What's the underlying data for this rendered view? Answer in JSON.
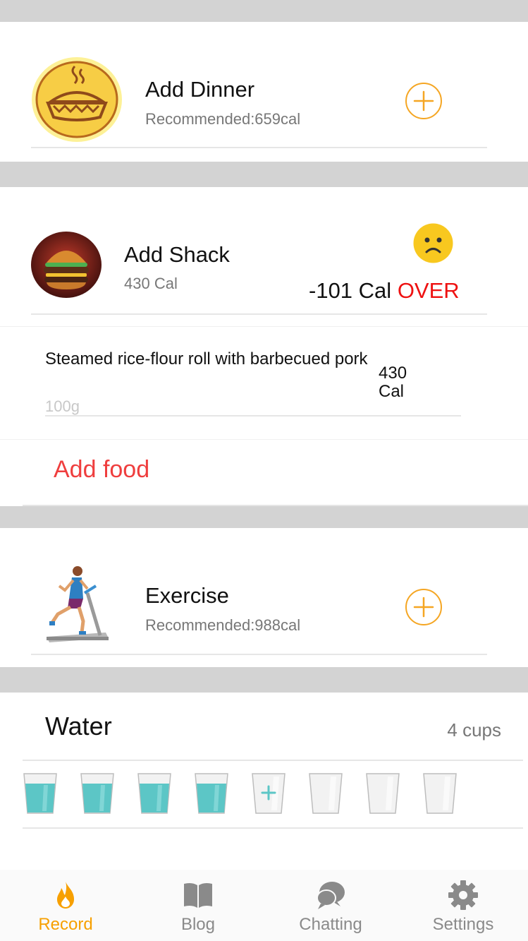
{
  "dinner": {
    "title": "Add Dinner",
    "recommended": "Recommended:659cal",
    "icon": "pie-icon"
  },
  "snack": {
    "title": "Add Shack",
    "calories": "430 Cal",
    "status_mood_icon": "sad-face-icon",
    "over_amount": "-101 Cal",
    "over_label": "OVER",
    "over_color": "#ee1111",
    "items": [
      {
        "name": "Steamed rice-flour roll with barbecued pork",
        "weight": "100g",
        "calories": "430 Cal"
      }
    ],
    "add_food_label": "Add food"
  },
  "exercise": {
    "title": "Exercise",
    "recommended": "Recommended:988cal",
    "icon": "treadmill-runner-icon"
  },
  "water": {
    "title": "Water",
    "count": "4 cups",
    "cups_filled": 4,
    "cups_total": 8
  },
  "tabs": [
    {
      "label": "Record",
      "icon": "flame-icon",
      "active": true
    },
    {
      "label": "Blog",
      "icon": "book-icon",
      "active": false
    },
    {
      "label": "Chatting",
      "icon": "chat-bubbles-icon",
      "active": false
    },
    {
      "label": "Settings",
      "icon": "gear-icon",
      "active": false
    }
  ],
  "colors": {
    "accent_orange": "#f5a623",
    "active_tab": "#f7a000",
    "add_food_red": "#ef3e3e",
    "water_teal": "#5cc6c6"
  }
}
